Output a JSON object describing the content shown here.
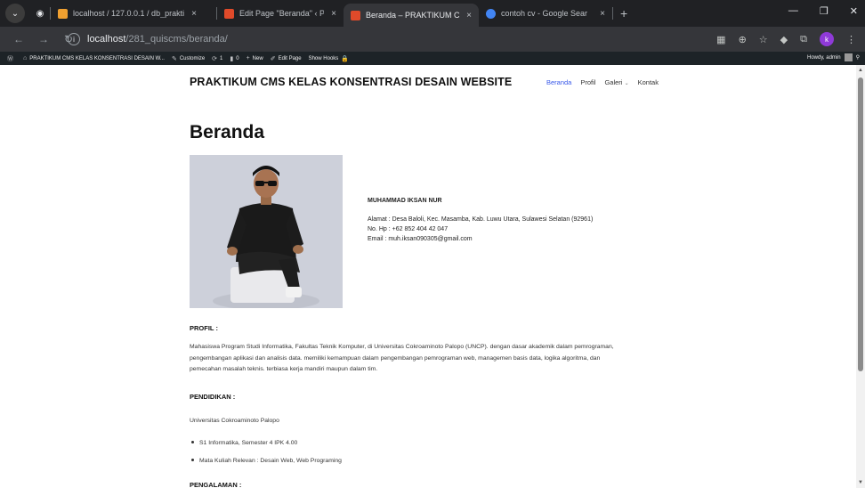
{
  "browser": {
    "tabs": [
      {
        "title": "localhost / 127.0.0.1 / db_prakti",
        "active": false,
        "favicon_color": "#f0a030"
      },
      {
        "title": "Edit Page \"Beranda\" ‹ PRAKTIK",
        "active": false,
        "favicon_color": "#e04a2a"
      },
      {
        "title": "Beranda – PRAKTIKUM CMS KE",
        "active": true,
        "favicon_color": "#e04a2a"
      },
      {
        "title": "contoh cv - Google Search",
        "active": false,
        "favicon_color": "#4285f4"
      }
    ],
    "tab_close_glyph": "×",
    "new_tab_glyph": "+",
    "url_host": "localhost",
    "url_path": "/281_quiscms/beranda/",
    "avatar_letter": "k"
  },
  "adminbar": {
    "site_name": "PRAKTIKUM CMS KELAS KONSENTRASI DESAIN W...",
    "customize": "Customize",
    "updates": "1",
    "comments": "0",
    "new": "New",
    "edit_page": "Edit Page",
    "show_hooks": "Show Hooks",
    "howdy": "Howdy, admin"
  },
  "site": {
    "title": "PRAKTIKUM CMS KELAS KONSENTRASI DESAIN WEBSITE",
    "nav": [
      {
        "label": "Beranda",
        "active": true
      },
      {
        "label": "Profil",
        "active": false
      },
      {
        "label": "Galeri",
        "active": false,
        "dropdown": true
      },
      {
        "label": "Kontak",
        "active": false
      }
    ]
  },
  "page": {
    "title": "Beranda",
    "person": {
      "name": "MUHAMMAD IKSAN NUR",
      "address": "Alamat : Desa Baloli, Kec. Masamba, Kab. Luwu Utara, Sulawesi Selatan (92961)",
      "phone": "No. Hp : +62 852 404 42 047",
      "email": "Email : muh.iksan090305@gmail.com"
    },
    "profil": {
      "heading": "PROFIL :",
      "lines": [
        "Mahasiswa Program Studi Informatika, Fakultas Teknik Komputer, di Universitas Cokroaminoto Palopo (UNCP). dengan dasar akademik dalam pemrograman,",
        "pengembangan aplikasi dan analisis data. memiliki kemampuan dalam pengembangan pemrograman web, managemen basis data, logika algoritma, dan",
        "pemecahan masalah teknis. terbiasa kerja mandiri maupun dalam tim."
      ]
    },
    "pendidikan": {
      "heading": "PENDIDIKAN :",
      "institution": "Universitas Cokroaminoto Palopo",
      "items": [
        "S1 Informatika, Semester 4 IPK 4.00",
        "Mata Kuliah Relevan : Desain Web, Web Programing"
      ]
    },
    "pengalaman": {
      "heading": "PENGALAMAN :"
    }
  }
}
